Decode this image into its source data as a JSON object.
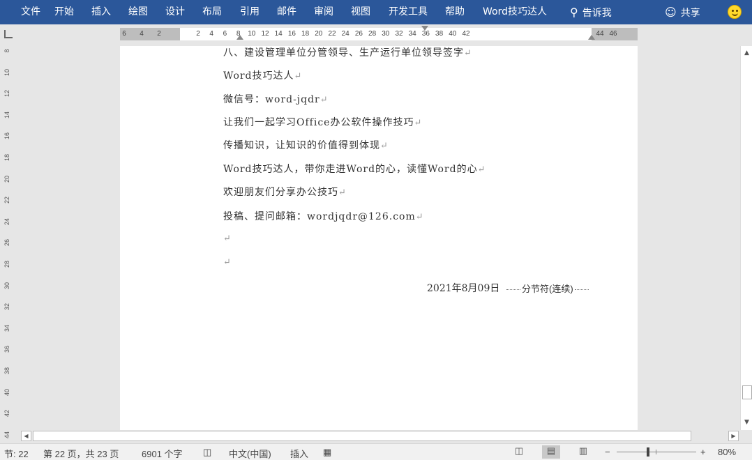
{
  "ribbon": {
    "tabs": [
      "文件",
      "开始",
      "插入",
      "绘图",
      "设计",
      "布局",
      "引用",
      "邮件",
      "审阅",
      "视图",
      "开发工具",
      "帮助",
      "Word技巧达人"
    ],
    "tell_me": "告诉我",
    "share": "共享",
    "tell_me_icon": "lightbulb-icon",
    "share_icon": "person-add-icon",
    "feedback_icon": "smiley-icon",
    "accent": "#2b579a"
  },
  "ruler": {
    "left_numbers": [
      "6",
      "4",
      "2"
    ],
    "numbers": [
      "2",
      "4",
      "6",
      "8",
      "10",
      "12",
      "14",
      "16",
      "18",
      "20",
      "22",
      "24",
      "26",
      "28",
      "30",
      "32",
      "34",
      "36",
      "38",
      "40",
      "42"
    ],
    "right_numbers": [
      "44",
      "46"
    ],
    "vertical_numbers": [
      "8",
      "10",
      "12",
      "14",
      "16",
      "18",
      "20",
      "22",
      "24",
      "26",
      "28",
      "30",
      "32",
      "34",
      "36",
      "38",
      "40",
      "42",
      "44"
    ]
  },
  "document": {
    "heading": "八、建设管理单位分管领导、生产运行单位领导签字",
    "lines": [
      "Word技巧达人",
      "微信号：word-jqdr",
      "让我们一起学习Office办公软件操作技巧",
      "传播知识，让知识的价值得到体现",
      "Word技巧达人，带你走进Word的心，读懂Word的心",
      "欢迎朋友们分享办公技巧",
      "投稿、提问邮箱：wordjqdr@126.com",
      "",
      ""
    ],
    "paragraph_mark": "↵",
    "date": "2021年8月09日",
    "section_break": "分节符(连续)"
  },
  "status": {
    "section": "节: 22",
    "page": "第 22 页，共 23 页",
    "words": "6901 个字",
    "language": "中文(中国)",
    "mode": "插入",
    "zoom": "80%",
    "zoom_minus": "−",
    "zoom_plus": "+"
  }
}
